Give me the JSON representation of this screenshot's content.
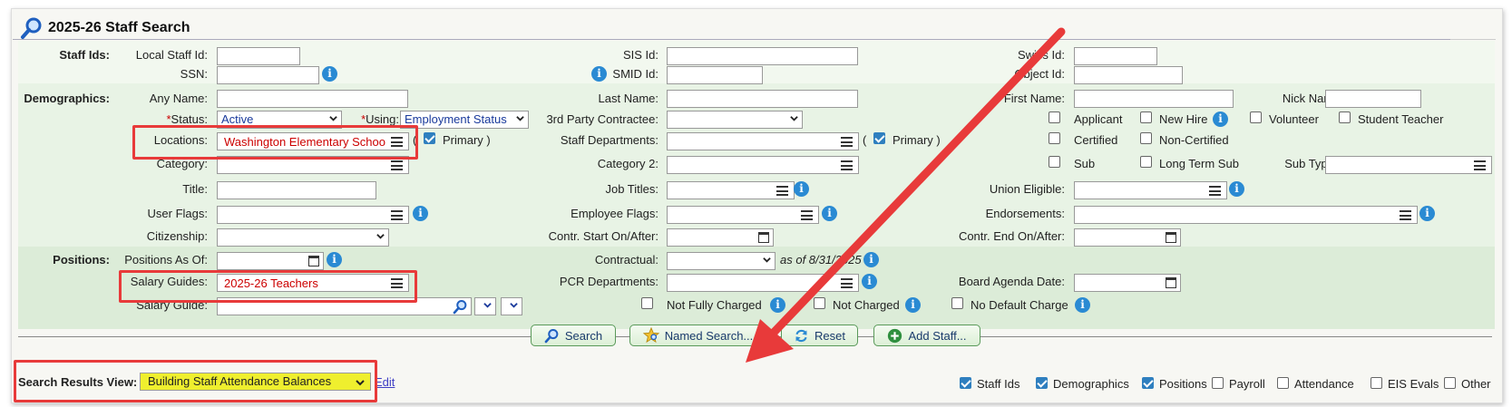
{
  "page": {
    "title": "2025-26 Staff Search"
  },
  "sections": {
    "staff_ids": "Staff Ids:",
    "demographics": "Demographics:",
    "positions": "Positions:"
  },
  "labels": {
    "local_staff_id": "Local Staff Id:",
    "sis_id": "SIS Id:",
    "swiss_id": "Swiss Id:",
    "ssn": "SSN:",
    "smid_id": "SMID Id:",
    "object_id": "Object Id:",
    "any_name": "Any Name:",
    "last_name": "Last Name:",
    "first_name": "First Name:",
    "nick_name": "Nick Name:",
    "status": "Status:",
    "using": "Using:",
    "third_party": "3rd Party Contractee:",
    "locations": "Locations:",
    "staff_departments": "Staff Departments:",
    "category": "Category:",
    "category2": "Category 2:",
    "sub_types": "Sub Types:",
    "title": "Title:",
    "job_titles": "Job Titles:",
    "union_eligible": "Union Eligible:",
    "user_flags": "User Flags:",
    "employee_flags": "Employee Flags:",
    "endorsements": "Endorsements:",
    "citizenship": "Citizenship:",
    "contr_start": "Contr. Start On/After:",
    "contr_end": "Contr. End On/After:",
    "positions_as_of": "Positions As Of:",
    "contractual": "Contractual:",
    "as_of": "as of 8/31/2025",
    "salary_guides": "Salary Guides:",
    "pcr_departments": "PCR Departments:",
    "board_agenda_date": "Board Agenda Date:",
    "salary_guide": "Salary Guide:",
    "search_results_view": "Search Results View:",
    "primary": "Primary",
    "paren_open": "(",
    "paren_close": ")",
    "asterisk": "*"
  },
  "values": {
    "status": "Active",
    "using": "Employment Status",
    "locations": "Washington Elementary School",
    "salary_guides": "2025-26 Teachers",
    "search_results_view": "Building Staff Attendance Balances"
  },
  "checkboxes": {
    "applicant": "Applicant",
    "new_hire": "New Hire",
    "volunteer": "Volunteer",
    "student_teacher": "Student Teacher",
    "certified": "Certified",
    "non_certified": "Non-Certified",
    "sub": "Sub",
    "long_term_sub": "Long Term Sub",
    "not_fully_charged": "Not Fully Charged",
    "not_charged": "Not Charged",
    "no_default_charge": "No Default Charge"
  },
  "buttons": {
    "search": "Search",
    "named_search": "Named Search...",
    "reset": "Reset",
    "add_staff": "Add Staff...",
    "edit": "Edit"
  },
  "view_toggles": [
    {
      "label": "Staff Ids",
      "checked": true
    },
    {
      "label": "Demographics",
      "checked": true
    },
    {
      "label": "Positions",
      "checked": true
    },
    {
      "label": "Payroll",
      "checked": false
    },
    {
      "label": "Attendance",
      "checked": false
    },
    {
      "label": "EIS Evals",
      "checked": false
    },
    {
      "label": "Other",
      "checked": false
    }
  ],
  "colors": {
    "highlight": "#e83a3a",
    "required": "#c00000",
    "info": "#2a8ad3",
    "results_view_bg": "#efef2e"
  }
}
